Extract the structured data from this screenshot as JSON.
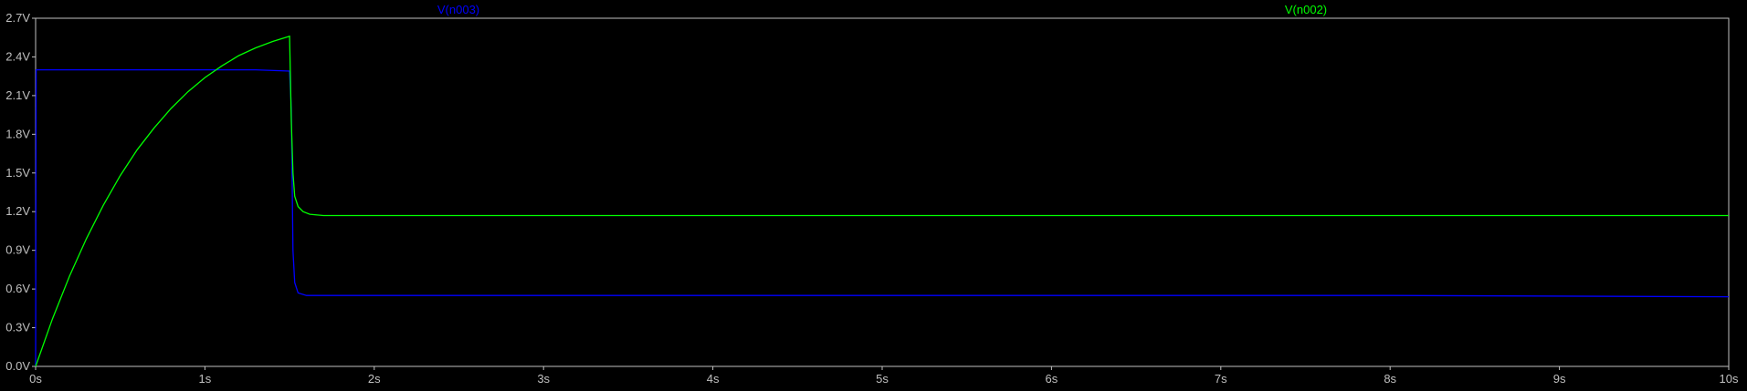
{
  "chart_data": {
    "type": "line",
    "title": "",
    "xlabel": "",
    "ylabel": "",
    "xlim": [
      0,
      10
    ],
    "ylim": [
      0,
      2.7
    ],
    "x_ticks": [
      {
        "value": 0,
        "label": "0s"
      },
      {
        "value": 1,
        "label": "1s"
      },
      {
        "value": 2,
        "label": "2s"
      },
      {
        "value": 3,
        "label": "3s"
      },
      {
        "value": 4,
        "label": "4s"
      },
      {
        "value": 5,
        "label": "5s"
      },
      {
        "value": 6,
        "label": "6s"
      },
      {
        "value": 7,
        "label": "7s"
      },
      {
        "value": 8,
        "label": "8s"
      },
      {
        "value": 9,
        "label": "9s"
      },
      {
        "value": 10,
        "label": "10s"
      }
    ],
    "y_ticks": [
      {
        "value": 0.0,
        "label": "0.0V"
      },
      {
        "value": 0.3,
        "label": "0.3V"
      },
      {
        "value": 0.6,
        "label": "0.6V"
      },
      {
        "value": 0.9,
        "label": "0.9V"
      },
      {
        "value": 1.2,
        "label": "1.2V"
      },
      {
        "value": 1.5,
        "label": "1.5V"
      },
      {
        "value": 1.8,
        "label": "1.8V"
      },
      {
        "value": 2.1,
        "label": "2.1V"
      },
      {
        "value": 2.4,
        "label": "2.4V"
      },
      {
        "value": 2.7,
        "label": "2.7V"
      }
    ],
    "grid": false,
    "legend": "top",
    "series": [
      {
        "name": "V(n003)",
        "color": "#0000ff",
        "x": [
          0,
          0.003,
          0.02,
          0.2,
          0.5,
          1.0,
          1.3,
          1.5,
          1.51,
          1.52,
          1.53,
          1.55,
          1.6,
          2.0,
          4.0,
          6.0,
          8.0,
          10.0
        ],
        "y": [
          0,
          2.3,
          2.3,
          2.3,
          2.3,
          2.3,
          2.3,
          2.29,
          2.0,
          0.9,
          0.65,
          0.57,
          0.55,
          0.55,
          0.55,
          0.55,
          0.55,
          0.54
        ]
      },
      {
        "name": "V(n002)",
        "color": "#00ff00",
        "x": [
          0,
          0.1,
          0.2,
          0.3,
          0.4,
          0.5,
          0.6,
          0.7,
          0.8,
          0.9,
          1.0,
          1.1,
          1.2,
          1.3,
          1.4,
          1.5,
          1.51,
          1.52,
          1.53,
          1.55,
          1.58,
          1.62,
          1.7,
          2.0,
          4.0,
          6.0,
          8.0,
          10.0
        ],
        "y": [
          0,
          0.37,
          0.7,
          0.99,
          1.25,
          1.48,
          1.68,
          1.85,
          2.0,
          2.13,
          2.24,
          2.33,
          2.41,
          2.47,
          2.52,
          2.56,
          1.9,
          1.5,
          1.32,
          1.24,
          1.2,
          1.18,
          1.17,
          1.17,
          1.17,
          1.17,
          1.17,
          1.17
        ]
      }
    ]
  }
}
